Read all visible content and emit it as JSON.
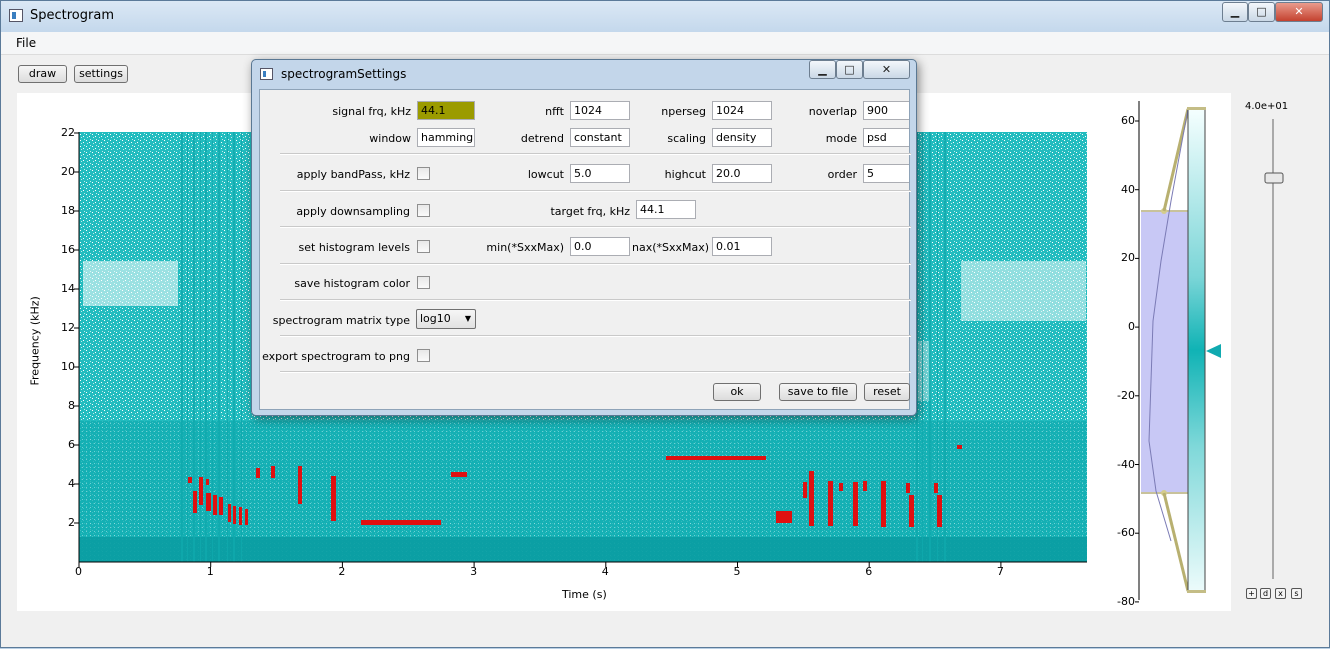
{
  "window": {
    "title": "Spectrogram",
    "buttons": {
      "minimize": "▁",
      "maximize": "□",
      "close": "✕"
    }
  },
  "menu": {
    "file": "File"
  },
  "toolbar": {
    "draw": "draw",
    "settings": "settings"
  },
  "plot": {
    "xlabel": "Time (s)",
    "ylabel": "Frequency (kHz)",
    "xticks": [
      "0",
      "1",
      "2",
      "3",
      "4",
      "5",
      "6",
      "7"
    ],
    "yticks": [
      "2",
      "4",
      "6",
      "8",
      "10",
      "12",
      "14",
      "16",
      "18",
      "20",
      "22"
    ],
    "colors": {
      "spectrum": "#17b5b8",
      "highlight": "#e01010"
    }
  },
  "histogram": {
    "ticks": [
      "60",
      "40",
      "20",
      "0",
      "-20",
      "-40",
      "-60",
      "-80"
    ],
    "level_label": "4.0e+01",
    "buttons": [
      "+",
      "d",
      "x",
      "s"
    ],
    "region_color": "#c8c8f5"
  },
  "dialog": {
    "title": "spectrogramSettings",
    "buttons": {
      "minimize": "▁",
      "maximize": "□",
      "close": "✕"
    },
    "fields": {
      "signal_frq_label": "signal frq, kHz",
      "signal_frq_value": "44.1",
      "nfft_label": "nfft",
      "nfft_value": "1024",
      "nperseg_label": "nperseg",
      "nperseg_value": "1024",
      "noverlap_label": "noverlap",
      "noverlap_value": "900",
      "window_label": "window",
      "window_value": "hamming",
      "detrend_label": "detrend",
      "detrend_value": "constant",
      "scaling_label": "scaling",
      "scaling_value": "density",
      "mode_label": "mode",
      "mode_value": "psd",
      "bandpass_label": "apply bandPass, kHz",
      "lowcut_label": "lowcut",
      "lowcut_value": "5.0",
      "highcut_label": "highcut",
      "highcut_value": "20.0",
      "order_label": "order",
      "order_value": "5",
      "downsampling_label": "apply downsampling",
      "target_frq_label": "target frq, kHz",
      "target_frq_value": "44.1",
      "histogram_levels_label": "set histogram levels",
      "min_label": "min(*SxxMax)",
      "min_value": "0.0",
      "max_label": "nax(*SxxMax)",
      "max_value": "0.01",
      "save_hist_color_label": "save histogram color",
      "matrix_type_label": "spectrogram matrix type",
      "matrix_type_value": "log10",
      "export_png_label": "export spectrogram to png"
    },
    "actions": {
      "ok": "ok",
      "save": "save to file",
      "reset": "reset"
    }
  }
}
